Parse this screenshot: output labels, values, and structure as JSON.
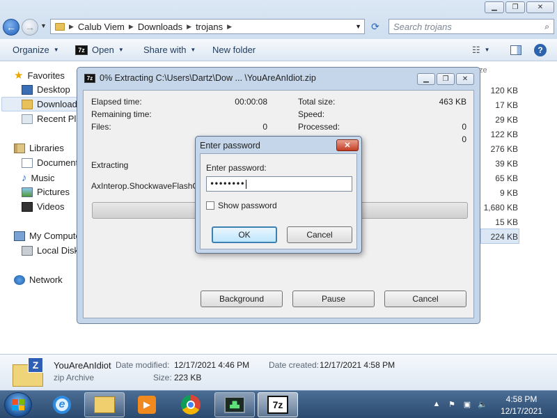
{
  "explorer": {
    "address": [
      "Calub Viem",
      "Downloads",
      "trojans"
    ],
    "search_placeholder": "Search trojans",
    "toolbar": {
      "organize": "Organize",
      "open": "Open",
      "share_with": "Share with",
      "new_folder": "New folder"
    },
    "nav": {
      "favorites": "Favorites",
      "desktop": "Desktop",
      "downloads": "Downloads",
      "recent": "Recent Plac",
      "libraries": "Libraries",
      "documents": "Documents",
      "music": "Music",
      "pictures": "Pictures",
      "videos": "Videos",
      "computer": "My Compute",
      "local_disk": "Local Disk (",
      "network": "Network"
    },
    "size_column_hint": "ze",
    "file_sizes": [
      "120 KB",
      "17 KB",
      "29 KB",
      "122 KB",
      "276 KB",
      "39 KB",
      "65 KB",
      "9 KB",
      "1,680 KB",
      "15 KB",
      "224 KB"
    ],
    "details": {
      "name": "YouAreAnIdiot",
      "type": "zip Archive",
      "date_modified_label": "Date modified:",
      "date_modified": "12/17/2021 4:46 PM",
      "size_label": "Size:",
      "size": "223 KB",
      "date_created_label": "Date created:",
      "date_created": "12/17/2021 4:58 PM"
    }
  },
  "progress_dialog": {
    "title": "0% Extracting C:\\Users\\Dartz\\Dow ... \\YouAreAnIdiot.zip",
    "elapsed_label": "Elapsed time:",
    "elapsed_value": "00:00:08",
    "remaining_label": "Remaining time:",
    "files_label": "Files:",
    "files_value": "0",
    "total_size_label": "Total size:",
    "total_size_value": "463 KB",
    "speed_label": "Speed:",
    "processed_label": "Processed:",
    "processed_value": "0",
    "extra_value": "0",
    "extracting_label": "Extracting",
    "current_file": "AxInterop.ShockwaveFlashObje",
    "progress": 0.0,
    "background_btn": "Background",
    "pause_btn": "Pause",
    "cancel_btn": "Cancel"
  },
  "password_dialog": {
    "title": "Enter password",
    "prompt": "Enter password:",
    "masked_value": "••••••••",
    "show_password_label": "Show password",
    "show_password_checked": false,
    "ok": "OK",
    "cancel": "Cancel"
  },
  "taskbar": {
    "time": "4:58 PM",
    "date": "12/17/2021",
    "apps": [
      "internet-explorer",
      "windows-explorer",
      "media-player",
      "chrome",
      "task-monitor",
      "7zip"
    ]
  },
  "colors": {
    "dialog_frame": "#c5d6ea",
    "close_button": "#c43c23",
    "taskbar": "#2a4a70"
  }
}
